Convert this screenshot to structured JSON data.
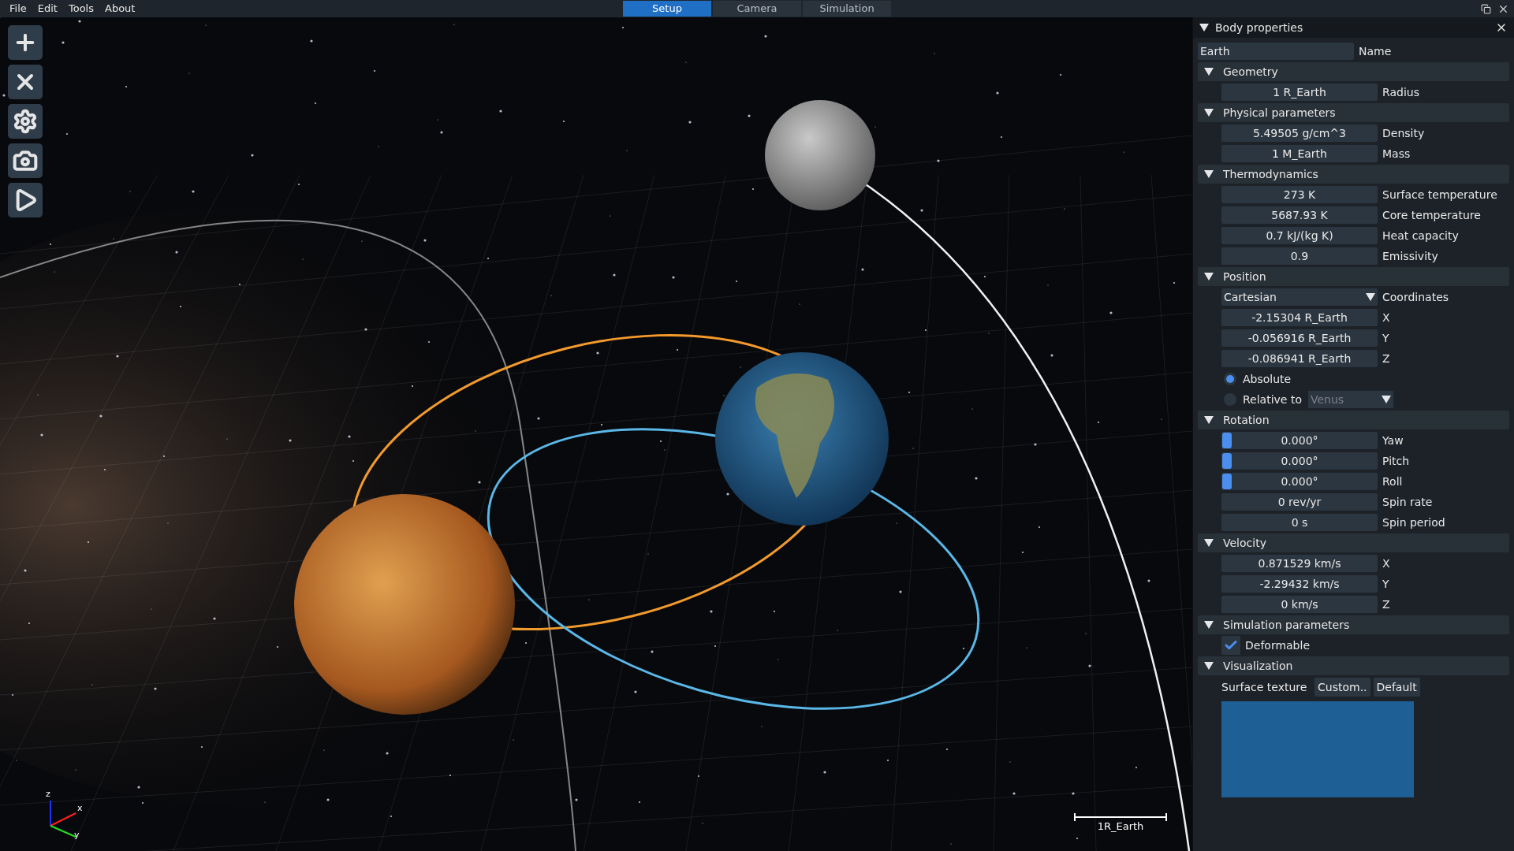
{
  "menu": [
    "File",
    "Edit",
    "Tools",
    "About"
  ],
  "tabs": [
    {
      "label": "Setup",
      "selected": true
    },
    {
      "label": "Camera",
      "selected": false
    },
    {
      "label": "Simulation",
      "selected": false
    }
  ],
  "viewport": {
    "axes": [
      "z",
      "x",
      "y"
    ],
    "scale_label": "1R_Earth"
  },
  "panel": {
    "title": "Body properties",
    "expanded": true,
    "name_value": "Earth",
    "name_label": "Name",
    "sections": [
      {
        "title": "Geometry",
        "expanded": true,
        "rows": [
          {
            "kind": "field",
            "value": "1 R_Earth",
            "label": "Radius"
          }
        ]
      },
      {
        "title": "Physical parameters",
        "expanded": true,
        "rows": [
          {
            "kind": "field",
            "value": "5.49505 g/cm^3",
            "label": "Density"
          },
          {
            "kind": "field",
            "value": "1 M_Earth",
            "label": "Mass"
          }
        ]
      },
      {
        "title": "Thermodynamics",
        "expanded": true,
        "rows": [
          {
            "kind": "field",
            "value": "273 K",
            "label": "Surface temperature"
          },
          {
            "kind": "field",
            "value": "5687.93 K",
            "label": "Core temperature"
          },
          {
            "kind": "field",
            "value": "0.7 kJ/(kg K)",
            "label": "Heat capacity"
          },
          {
            "kind": "field",
            "value": "0.9",
            "label": "Emissivity"
          }
        ]
      },
      {
        "title": "Position",
        "expanded": true,
        "rows": [
          {
            "kind": "dropdown",
            "value": "Cartesian",
            "label": "Coordinates"
          },
          {
            "kind": "field",
            "value": "-2.15304 R_Earth",
            "label": "X"
          },
          {
            "kind": "field",
            "value": "-0.056916 R_Earth",
            "label": "Y"
          },
          {
            "kind": "field",
            "value": "-0.086941 R_Earth",
            "label": "Z"
          },
          {
            "kind": "radio",
            "label": "Absolute",
            "selected": true
          },
          {
            "kind": "radio_dropdown",
            "label": "Relative to",
            "selected": false,
            "value": "Venus",
            "disabled": true
          }
        ]
      },
      {
        "title": "Rotation",
        "expanded": true,
        "rows": [
          {
            "kind": "slider",
            "value": "0.000°",
            "label": "Yaw",
            "level": 0
          },
          {
            "kind": "slider",
            "value": "0.000°",
            "label": "Pitch",
            "level": 0
          },
          {
            "kind": "slider",
            "value": "0.000°",
            "label": "Roll",
            "level": 0
          },
          {
            "kind": "field",
            "value": "0 rev/yr",
            "label": "Spin rate"
          },
          {
            "kind": "field",
            "value": "0 s",
            "label": "Spin period"
          }
        ]
      },
      {
        "title": "Velocity",
        "expanded": true,
        "rows": [
          {
            "kind": "field",
            "value": "0.871529 km/s",
            "label": "X"
          },
          {
            "kind": "field",
            "value": "-2.29432 km/s",
            "label": "Y"
          },
          {
            "kind": "field",
            "value": "0 km/s",
            "label": "Z"
          }
        ]
      },
      {
        "title": "Simulation parameters",
        "expanded": true,
        "rows": [
          {
            "kind": "checkbox",
            "label": "Deformable",
            "checked": true
          }
        ]
      },
      {
        "title": "Visualization",
        "expanded": true,
        "rows": [
          {
            "kind": "texture",
            "label": "Surface texture",
            "buttons": [
              "Custom..",
              "Default"
            ]
          }
        ]
      }
    ]
  }
}
